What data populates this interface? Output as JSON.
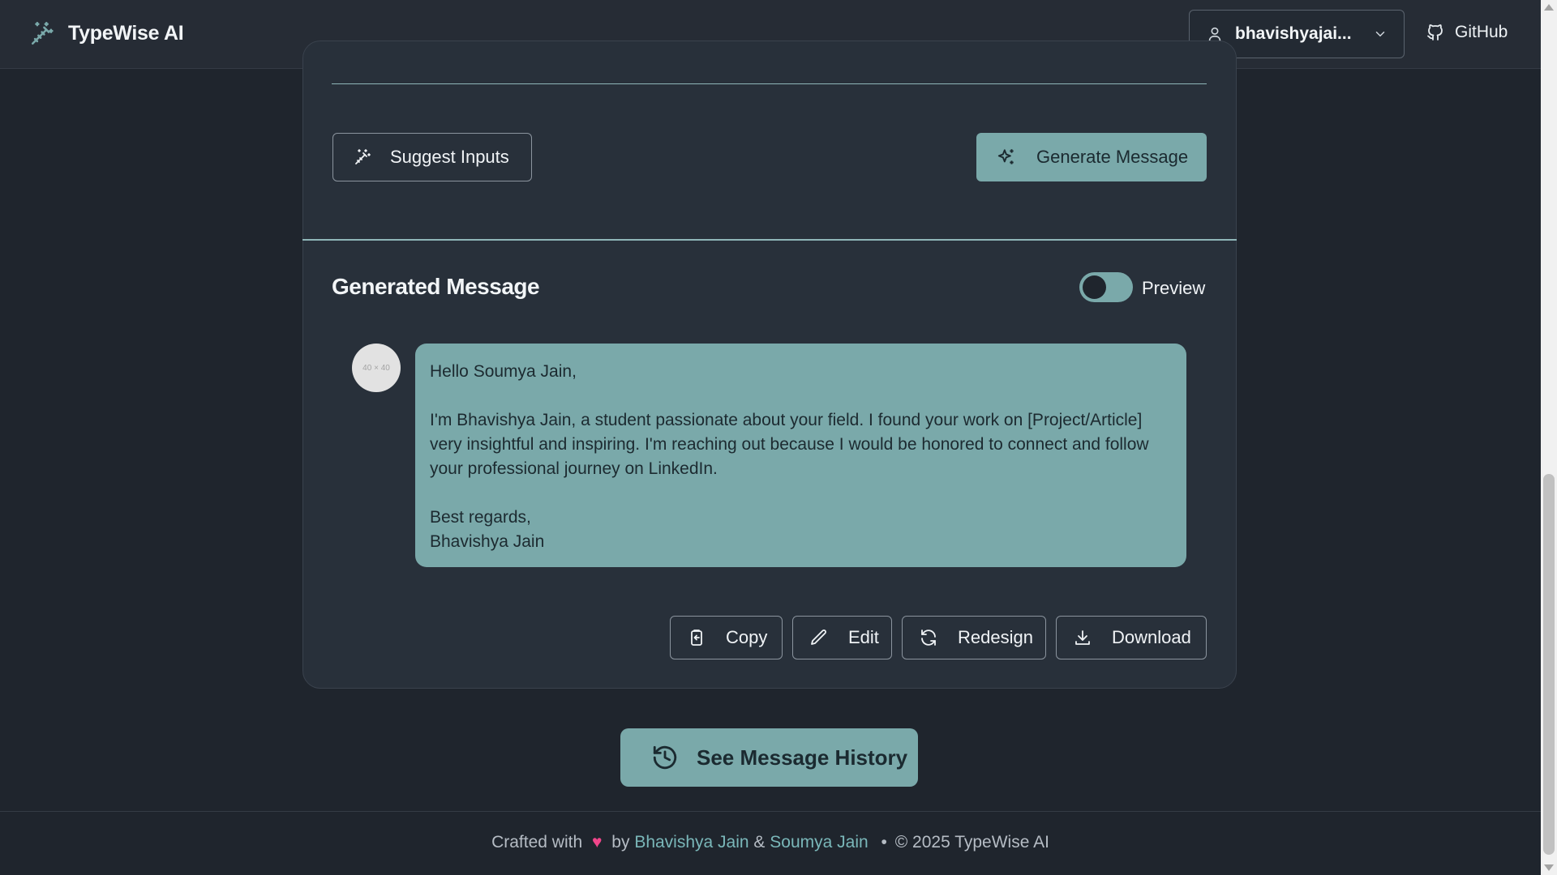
{
  "header": {
    "brand_name": "TypeWise AI",
    "user_label": "bhavishyajai...",
    "github_label": "GitHub"
  },
  "form": {
    "suggest_label": "Suggest Inputs",
    "generate_label": "Generate Message"
  },
  "generated": {
    "title": "Generated Message",
    "preview_label": "Preview",
    "preview_enabled": false,
    "avatar_placeholder": "40 × 40",
    "message": "Hello Soumya Jain,\n\nI'm Bhavishya Jain, a student passionate about your field. I found your work on [Project/Article] very insightful and inspiring. I'm reaching out because I would be honored to connect and follow your professional journey on LinkedIn.\n\nBest regards,\nBhavishya Jain",
    "actions": {
      "copy": "Copy",
      "edit": "Edit",
      "redesign": "Redesign",
      "download": "Download"
    }
  },
  "history_label": "See Message History",
  "footer": {
    "crafted": "Crafted with",
    "heart": "♥",
    "by": "by",
    "author1": "Bhavishya Jain",
    "amp": "&",
    "author2": "Soumya Jain",
    "dot": "•",
    "copyright": "© 2025 TypeWise AI"
  },
  "colors": {
    "accent": "#7aa9aa",
    "background": "#1f252d",
    "card": "#28303a",
    "link": "#7ab7b9",
    "heart": "#f0468a"
  }
}
